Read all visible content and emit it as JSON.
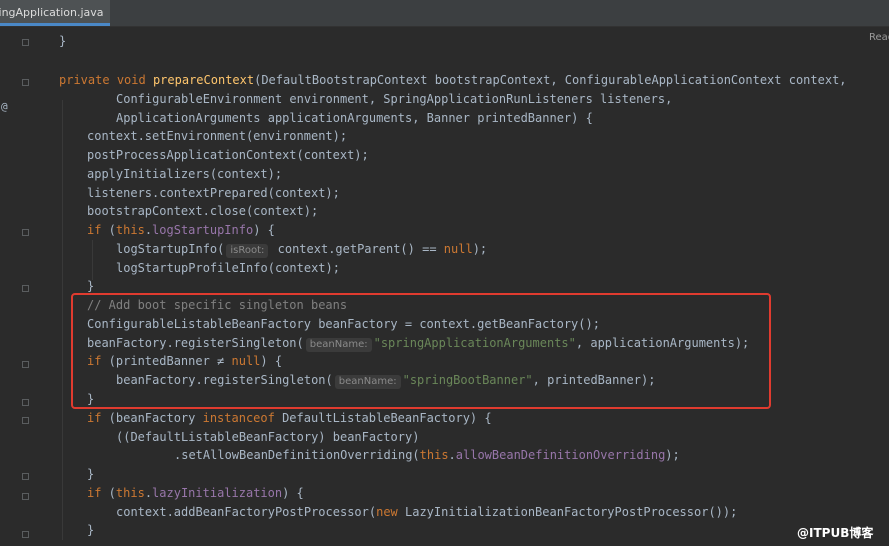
{
  "tab": {
    "label": "ringApplication.java",
    "close": "×"
  },
  "reader_mode": "Read",
  "gutter": {
    "override_mark": "@"
  },
  "code": {
    "l01": "}",
    "l02_kw1": "private",
    "l02_kw2": "void",
    "l02_fn": "prepareContext",
    "l02_rest": "(DefaultBootstrapContext bootstrapContext, ConfigurableApplicationContext context,",
    "l03": "ConfigurableEnvironment environment, SpringApplicationRunListeners listeners,",
    "l04": "ApplicationArguments applicationArguments, Banner printedBanner) {",
    "l05": "context.setEnvironment(environment);",
    "l06": "postProcessApplicationContext(context);",
    "l07": "applyInitializers(context);",
    "l08": "listeners.contextPrepared(context);",
    "l09": "bootstrapContext.close(context);",
    "l10_kw": "if",
    "l10_a": " (",
    "l10_this": "this",
    "l10_dot": ".",
    "l10_fld": "logStartupInfo",
    "l10_b": ") {",
    "l11_a": "logStartupInfo(",
    "l11_hint": "isRoot:",
    "l11_b": " context.getParent() == ",
    "l11_kw": "null",
    "l11_c": ");",
    "l12": "logStartupProfileInfo(context);",
    "l13": "}",
    "l14": "// Add boot specific singleton beans",
    "l15": "ConfigurableListableBeanFactory beanFactory = context.getBeanFactory();",
    "l16_a": "beanFactory.registerSingleton(",
    "l16_hint": "beanName:",
    "l16_str": "\"springApplicationArguments\"",
    "l16_b": ", applicationArguments);",
    "l17_kw": "if",
    "l17_a": " (printedBanner ≠ ",
    "l17_null": "null",
    "l17_b": ") {",
    "l18_a": "beanFactory.registerSingleton(",
    "l18_hint": "beanName:",
    "l18_str": "\"springBootBanner\"",
    "l18_b": ", printedBanner);",
    "l19": "}",
    "l20_kw": "if",
    "l20_a": " (beanFactory ",
    "l20_kw2": "instanceof",
    "l20_b": " DefaultListableBeanFactory) {",
    "l21": "((DefaultListableBeanFactory) beanFactory)",
    "l22_a": ".setAllowBeanDefinitionOverriding(",
    "l22_this": "this",
    "l22_dot": ".",
    "l22_fld": "allowBeanDefinitionOverriding",
    "l22_b": ");",
    "l23": "}",
    "l24_kw": "if",
    "l24_a": " (",
    "l24_this": "this",
    "l24_dot": ".",
    "l24_fld": "lazyInitialization",
    "l24_b": ") {",
    "l25_a": "context.addBeanFactoryPostProcessor(",
    "l25_kw": "new",
    "l25_b": " LazyInitializationBeanFactoryPostProcessor());",
    "l26": "}"
  },
  "watermark": "@ITPUB博客",
  "colors": {
    "highlight_border": "#e03b2f",
    "background": "#2b2b2b",
    "keyword": "#cc7832",
    "string": "#6a8759"
  }
}
